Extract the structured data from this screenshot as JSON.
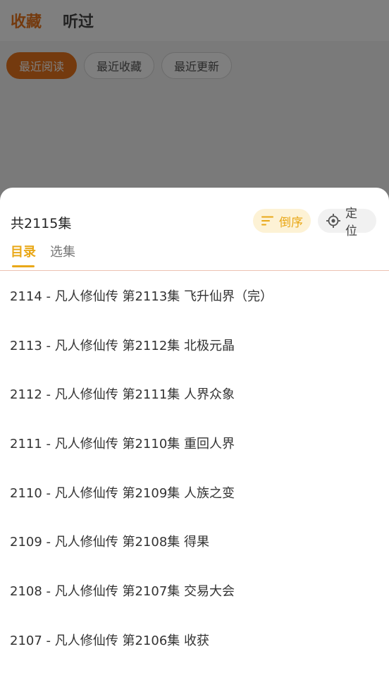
{
  "background": {
    "tabs": [
      {
        "label": "收藏",
        "active": true
      },
      {
        "label": "听过",
        "active": false
      }
    ],
    "filters": [
      {
        "label": "最近阅读",
        "active": true
      },
      {
        "label": "最近收藏",
        "active": false
      },
      {
        "label": "最近更新",
        "active": false
      }
    ]
  },
  "sheet": {
    "count_label": "共2115集",
    "sort_button": {
      "label": "倒序",
      "icon": "sort-icon"
    },
    "locate_button": {
      "label": "定位",
      "icon": "locate-icon"
    },
    "tabs": [
      {
        "label": "目录",
        "active": true
      },
      {
        "label": "选集",
        "active": false
      }
    ],
    "episodes": [
      "2114 - 凡人修仙传 第2113集 飞升仙界（完）",
      "2113 - 凡人修仙传 第2112集 北极元晶",
      "2112 - 凡人修仙传 第2111集 人界众象",
      "2111 - 凡人修仙传 第2110集 重回人界",
      "2110 - 凡人修仙传 第2109集 人族之变",
      "2109 - 凡人修仙传 第2108集 得果",
      "2108 - 凡人修仙传 第2107集 交易大会",
      "2107 - 凡人修仙传 第2106集 收获"
    ]
  },
  "colors": {
    "accent": "#e9a818",
    "brand_orange": "#e8741c",
    "divider": "#ecc2b2"
  }
}
